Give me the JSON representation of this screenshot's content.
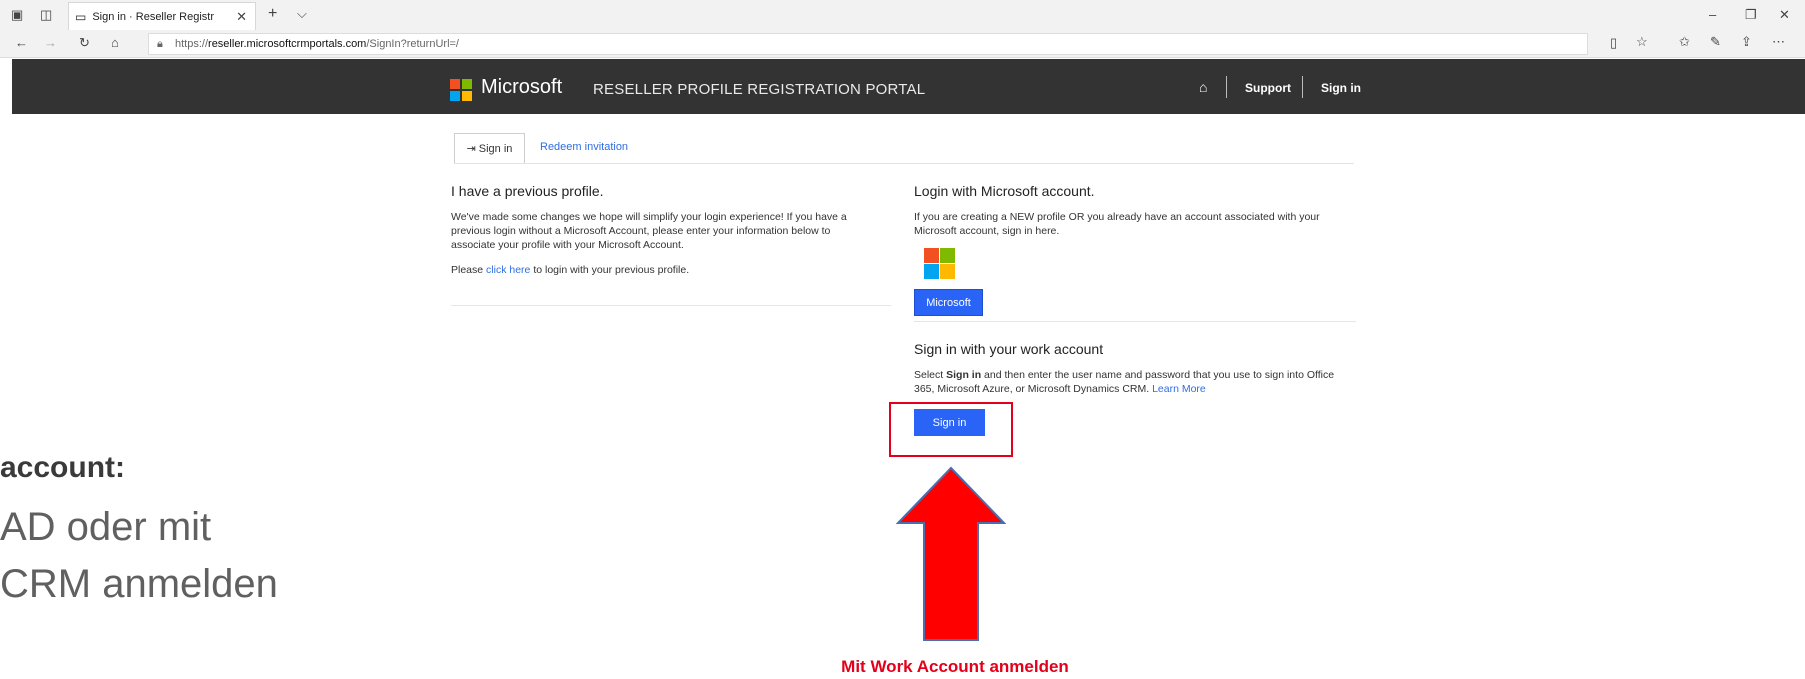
{
  "browser": {
    "tab_title": "Sign in · Reseller Registr",
    "tab_close": "✕",
    "new_tab": "+",
    "tab_list": "⌵",
    "url_prefix": "https://",
    "url_domain": "reseller.microsoftcrmportals.com",
    "url_path": "/SignIn?returnUrl=/",
    "window_min": "–",
    "window_max": "❐",
    "window_close": "✕"
  },
  "header": {
    "brand": "Microsoft",
    "portal_title": "RESELLER PROFILE REGISTRATION PORTAL",
    "home_icon": "⌂",
    "support": "Support",
    "signin": "Sign in"
  },
  "tabs": {
    "signin": "Sign in",
    "redeem": "Redeem invitation"
  },
  "left": {
    "heading": "I have a previous profile.",
    "body_line1": "We've made some changes we hope will simplify your login experience! If you have a",
    "body_line2": "previous login without a Microsoft Account, please enter your information below to",
    "body_line3": "associate your profile with your Microsoft Account.",
    "please": "Please",
    "click_here": "click here",
    "tail": "to login with your previous profile."
  },
  "right": {
    "ms_heading": "Login with Microsoft account.",
    "ms_body_line1": "If you are creating a NEW profile OR you already have an account associated with your",
    "ms_body_line2": "Microsoft account, sign in here.",
    "ms_button": "Microsoft",
    "work_heading": "Sign in with your work account",
    "work_select": "Select",
    "work_signin_bold": "Sign in",
    "work_body_line1": "and then enter the user name and password that you use to sign into Office",
    "work_body_line2": "365, Microsoft Azure, or Microsoft Dynamics CRM.",
    "learn_more": "Learn More",
    "signin_button": "Sign in"
  },
  "annotation": {
    "label": "Mit Work Account anmelden",
    "overlay_line1": "account:",
    "overlay_line2": "AD oder mit",
    "overlay_line3": "CRM anmelden"
  },
  "colors": {
    "accent_blue": "#2a64f6",
    "annotation_red": "#e3001b",
    "header_bg": "#333333"
  }
}
